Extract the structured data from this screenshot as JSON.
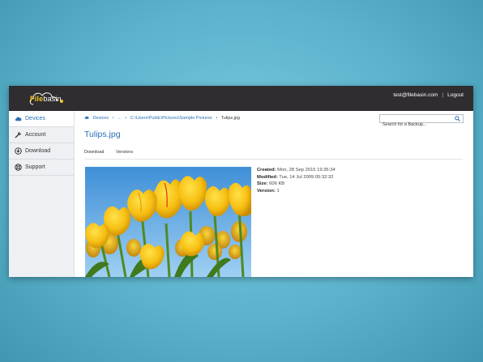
{
  "app": {
    "logo_text_main": "File",
    "logo_text_sub": "basin"
  },
  "header": {
    "user_email": "test@filebasin.com",
    "separator": "|",
    "logout_label": "Logout"
  },
  "sidebar": {
    "items": [
      {
        "label": "Devices",
        "icon": "cloud-icon",
        "active": true
      },
      {
        "label": "Account",
        "icon": "wrench-icon",
        "active": false
      },
      {
        "label": "Download",
        "icon": "download-icon",
        "active": false
      },
      {
        "label": "Support",
        "icon": "lifebuoy-icon",
        "active": false
      }
    ]
  },
  "breadcrumb": {
    "items": [
      "Devices",
      "...",
      "C:\\Users\\Public\\Pictures\\Sample Pictures",
      "Tulips.jpg"
    ]
  },
  "search": {
    "placeholder": "Search for a Backup..."
  },
  "file": {
    "title": "Tulips.jpg",
    "tabs": [
      "Download",
      "Versions"
    ],
    "created_label": "Created:",
    "created_value": "Mon, 28 Sep 2015 19:35:34",
    "modified_label": "Modified:",
    "modified_value": "Tue, 14 Jul 2009 05:32:32",
    "size_label": "Size:",
    "size_value": "606 KB",
    "version_label": "Version:",
    "version_value": "1"
  },
  "colors": {
    "accent": "#2a6fb7",
    "topbar": "#2f2d30",
    "logo": "#f4c51d"
  }
}
